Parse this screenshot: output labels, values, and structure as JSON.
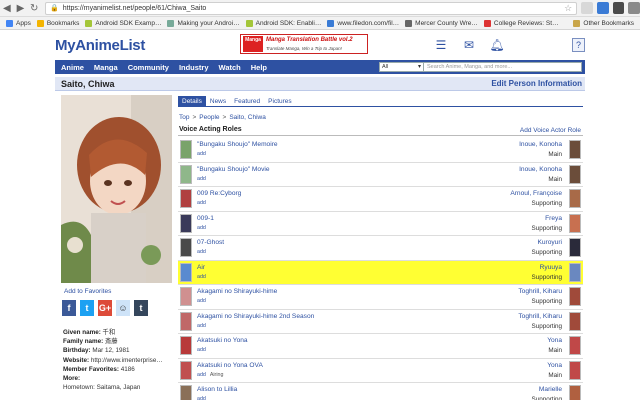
{
  "browser": {
    "url": "https://myanimelist.net/people/61/Chiwa_Saito",
    "bookmarks": [
      {
        "label": "Apps",
        "icon": "apps-grid-icon",
        "color": "#4285f4"
      },
      {
        "label": "Bookmarks",
        "icon": "star-icon",
        "color": "#f4b400"
      },
      {
        "label": "Android SDK Examp…",
        "icon": "page-icon",
        "color": "#a4c639"
      },
      {
        "label": "Making your Androi…",
        "icon": "page-icon",
        "color": "#7a9"
      },
      {
        "label": "Android SDK: Enabli…",
        "icon": "page-icon",
        "color": "#a4c639"
      },
      {
        "label": "www.filedon.com/fil…",
        "icon": "page-icon",
        "color": "#3a7bd5"
      },
      {
        "label": "Mercer County Wre…",
        "icon": "page-icon",
        "color": "#666"
      },
      {
        "label": "College Reviews: St…",
        "icon": "page-icon",
        "color": "#d33"
      }
    ],
    "other_bookmarks": "Other Bookmarks"
  },
  "header": {
    "logo": "MyAnimeList",
    "banner_tag": "Manga",
    "banner_title": "Manga Translation Battle vol.2",
    "banner_sub": "Translate Manga, Win a Trip to Japan!",
    "help_label": "?"
  },
  "menu": {
    "items": [
      "Anime",
      "Manga",
      "Community",
      "Industry",
      "Watch",
      "Help"
    ],
    "search_category": "All",
    "search_placeholder": "Search Anime, Manga, and more..."
  },
  "person": {
    "name": "Saito, Chiwa",
    "edit_label": "Edit Person Information",
    "add_favorites": "Add to Favorites",
    "info": [
      {
        "label": "Given name:",
        "value": "千和"
      },
      {
        "label": "Family name:",
        "value": "斎藤"
      },
      {
        "label": "Birthday:",
        "value": "Mar 12, 1981"
      },
      {
        "label": "Website:",
        "value": "http://www.imenterprise…"
      },
      {
        "label": "Member Favorites:",
        "value": "4186"
      },
      {
        "label": "More:",
        "value": ""
      },
      {
        "label": "",
        "value": "Hometown: Saitama, Japan"
      }
    ]
  },
  "social": [
    {
      "label": "f",
      "icon": "facebook-icon",
      "color": "#3b5998"
    },
    {
      "label": "t",
      "icon": "twitter-icon",
      "color": "#1da1f2"
    },
    {
      "label": "G+",
      "icon": "google-plus-icon",
      "color": "#dd4b39"
    },
    {
      "label": "☺",
      "icon": "reddit-icon",
      "color": "#cee3f8"
    },
    {
      "label": "t",
      "icon": "tumblr-icon",
      "color": "#35465c"
    }
  ],
  "tabs": [
    "Details",
    "News",
    "Featured",
    "Pictures"
  ],
  "breadcrumbs": [
    "Top",
    "People",
    "Saito, Chiwa"
  ],
  "roles_section": {
    "title": "Voice Acting Roles",
    "add_label": "Add Voice Actor Role",
    "rows": [
      {
        "title": "\"Bungaku Shoujo\" Memoire",
        "add": "add",
        "extra": "",
        "character": "Inoue, Konoha",
        "type": "Main",
        "highlight": false,
        "thumb": "#7aa36a",
        "cthumb": "#6b4d3a"
      },
      {
        "title": "\"Bungaku Shoujo\" Movie",
        "add": "add",
        "extra": "",
        "character": "Inoue, Konoha",
        "type": "Main",
        "highlight": false,
        "thumb": "#8fb78a",
        "cthumb": "#6b4d3a"
      },
      {
        "title": "009 Re:Cyborg",
        "add": "add",
        "extra": "",
        "character": "Arnoul, Françoise",
        "type": "Supporting",
        "highlight": false,
        "thumb": "#b04040",
        "cthumb": "#a86a48"
      },
      {
        "title": "009-1",
        "add": "add",
        "extra": "",
        "character": "Freya",
        "type": "Supporting",
        "highlight": false,
        "thumb": "#3a3a5a",
        "cthumb": "#c87050"
      },
      {
        "title": "07-Ghost",
        "add": "add",
        "extra": "",
        "character": "Kuroyuri",
        "type": "Supporting",
        "highlight": false,
        "thumb": "#4a4a4a",
        "cthumb": "#2a2a3a"
      },
      {
        "title": "Air",
        "add": "add",
        "extra": "",
        "character": "Ryuuya",
        "type": "Supporting",
        "highlight": true,
        "thumb": "#5a8ad0",
        "cthumb": "#6a88c0"
      },
      {
        "title": "Akagami no Shirayuki-hime",
        "add": "add",
        "extra": "",
        "character": "Toghrill, Kiharu",
        "type": "Supporting",
        "highlight": false,
        "thumb": "#d09090",
        "cthumb": "#a04a3a"
      },
      {
        "title": "Akagami no Shirayuki-hime 2nd Season",
        "add": "add",
        "extra": "",
        "character": "Toghrill, Kiharu",
        "type": "Supporting",
        "highlight": false,
        "thumb": "#c06868",
        "cthumb": "#a04a3a"
      },
      {
        "title": "Akatsuki no Yona",
        "add": "add",
        "extra": "",
        "character": "Yona",
        "type": "Main",
        "highlight": false,
        "thumb": "#b83a3a",
        "cthumb": "#c04848"
      },
      {
        "title": "Akatsuki no Yona OVA",
        "add": "add",
        "extra": "Airing",
        "character": "Yona",
        "type": "Main",
        "highlight": false,
        "thumb": "#c05050",
        "cthumb": "#c04848"
      },
      {
        "title": "Alison to Lillia",
        "add": "add",
        "extra": "",
        "character": "Marielle",
        "type": "Supporting",
        "highlight": false,
        "thumb": "#8a7058",
        "cthumb": "#b06040"
      }
    ]
  }
}
